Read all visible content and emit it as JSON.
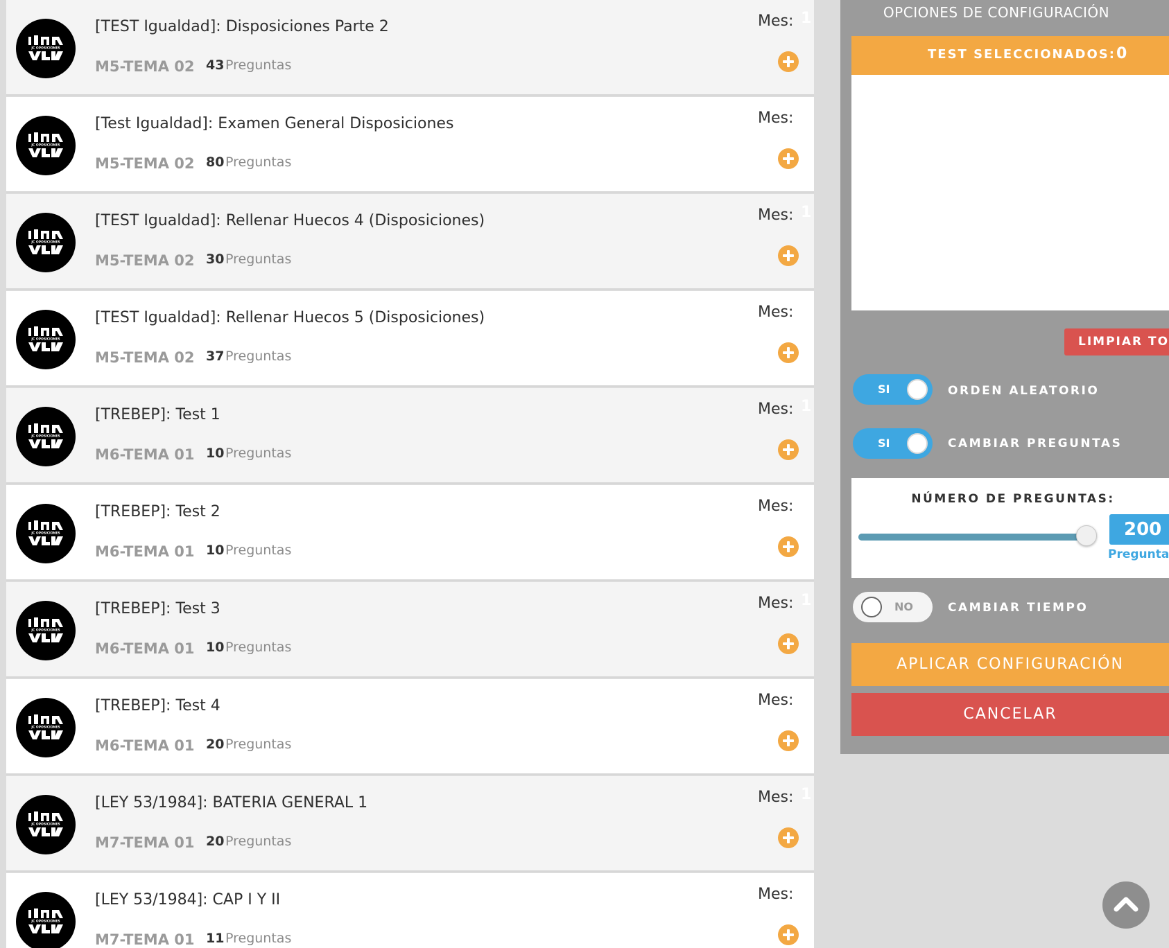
{
  "tests": [
    {
      "title": "[TEST Igualdad]: Disposiciones Parte 2",
      "code": "M5-TEMA 02",
      "count": "43",
      "questions_label": "Preguntas",
      "mes_label": "Mes:",
      "mes_value": "1"
    },
    {
      "title": "[Test Igualdad]: Examen General Disposiciones",
      "code": "M5-TEMA 02",
      "count": "80",
      "questions_label": "Preguntas",
      "mes_label": "Mes:",
      "mes_value": ""
    },
    {
      "title": "[TEST Igualdad]: Rellenar Huecos 4 (Disposiciones)",
      "code": "M5-TEMA 02",
      "count": "30",
      "questions_label": "Preguntas",
      "mes_label": "Mes:",
      "mes_value": "1"
    },
    {
      "title": "[TEST Igualdad]: Rellenar Huecos 5 (Disposiciones)",
      "code": "M5-TEMA 02",
      "count": "37",
      "questions_label": "Preguntas",
      "mes_label": "Mes:",
      "mes_value": ""
    },
    {
      "title": "[TREBEP]: Test 1",
      "code": "M6-TEMA 01",
      "count": "10",
      "questions_label": "Preguntas",
      "mes_label": "Mes:",
      "mes_value": "1"
    },
    {
      "title": "[TREBEP]: Test 2",
      "code": "M6-TEMA 01",
      "count": "10",
      "questions_label": "Preguntas",
      "mes_label": "Mes:",
      "mes_value": ""
    },
    {
      "title": "[TREBEP]: Test 3",
      "code": "M6-TEMA 01",
      "count": "10",
      "questions_label": "Preguntas",
      "mes_label": "Mes:",
      "mes_value": "1"
    },
    {
      "title": "[TREBEP]: Test 4",
      "code": "M6-TEMA 01",
      "count": "20",
      "questions_label": "Preguntas",
      "mes_label": "Mes:",
      "mes_value": ""
    },
    {
      "title": "[LEY 53/1984]: BATERIA GENERAL 1",
      "code": "M7-TEMA 01",
      "count": "20",
      "questions_label": "Preguntas",
      "mes_label": "Mes:",
      "mes_value": "1"
    },
    {
      "title": "[LEY 53/1984]: CAP I Y II",
      "code": "M7-TEMA 01",
      "count": "11",
      "questions_label": "Preguntas",
      "mes_label": "Mes:",
      "mes_value": ""
    }
  ],
  "config": {
    "title": "OPCIONES DE CONFIGURACIÓN",
    "selected_label": "TEST SELECCIONADOS:",
    "selected_count": "0",
    "clear_label": "LIMPIAR TODO",
    "random_order": {
      "state_label": "SI",
      "label": "ORDEN ALEATORIO",
      "on": true
    },
    "change_questions": {
      "state_label": "SI",
      "label": "CAMBIAR PREGUNTAS",
      "on": true
    },
    "num_questions_label": "NÚMERO DE PREGUNTAS:",
    "num_questions_value": "200",
    "num_questions_unit": "Preguntas",
    "slider_fraction": 1.0,
    "change_time": {
      "state_label": "NO",
      "label": "CAMBIAR TIEMPO",
      "on": false
    },
    "apply_label": "APLICAR CONFIGURACIÓN",
    "cancel_label": "CANCELAR"
  },
  "colors": {
    "accent_orange": "#f3a843",
    "toggle_blue": "#3ea7e1",
    "danger_red": "#d9534f",
    "panel_gray": "#9b9b9b"
  },
  "icons": {
    "card_logo": "jc-oposiciones-logo",
    "add": "plus-circle-icon",
    "scroll_top": "chevron-up-icon"
  }
}
